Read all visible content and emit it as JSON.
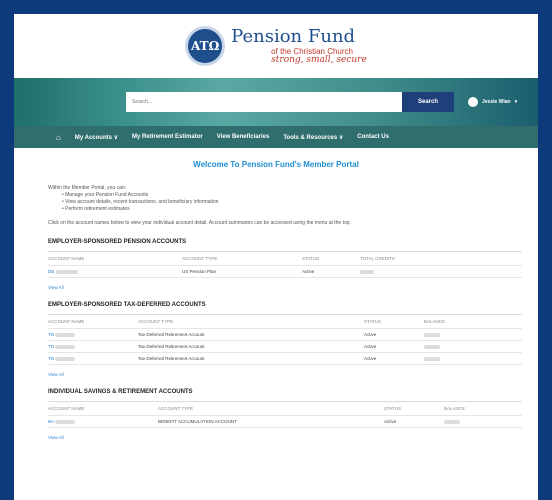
{
  "logo": {
    "title": "Pension Fund",
    "subtitle": "of the Christian Church",
    "tagline": "strong, small, secure",
    "mark": "ATΩ"
  },
  "search": {
    "placeholder": "Search...",
    "button": "Search"
  },
  "user": {
    "name": "Jessie Wian"
  },
  "nav": [
    "My Accounts ∨",
    "My Retirement Estimator",
    "View Beneficiaries",
    "Tools & Resources ∨",
    "Contact Us"
  ],
  "welcome": "Welcome To Pension Fund's Member Portal",
  "intro": {
    "lead": "Within the Member Portal, you can:",
    "bullets": [
      "Manage your Pension Fund Accounts",
      "View account details, recent transactions, and beneficiary information",
      "Perform retirement estimates"
    ],
    "note": "Click on the account names below to view your individual account detail. Account summaries can be accessed using the menu at the top."
  },
  "sections": [
    {
      "title": "EMPLOYER-SPONSORED PENSION ACCOUNTS",
      "headers": [
        "ACCOUNT NAME",
        "ACCOUNT TYPE",
        "STATUS",
        "TOTAL CREDITS"
      ],
      "rows": [
        {
          "name": "DB",
          "type": "US Pension Plan",
          "status": "Active"
        }
      ],
      "view_all": "View All"
    },
    {
      "title": "EMPLOYER-SPONSORED TAX-DEFERRED ACCOUNTS",
      "headers": [
        "ACCOUNT NAME",
        "ACCOUNT TYPE",
        "STATUS",
        "BALANCE"
      ],
      "rows": [
        {
          "name": "TD",
          "type": "Tax-Deferred Retirement Account",
          "status": "Active"
        },
        {
          "name": "TD",
          "type": "Tax-Deferred Retirement Account",
          "status": "Active"
        },
        {
          "name": "TD",
          "type": "Tax-Deferred Retirement Account",
          "status": "Active"
        }
      ],
      "view_all": "View All"
    },
    {
      "title": "INDIVIDUAL SAVINGS & RETIREMENT ACCOUNTS",
      "headers": [
        "ACCOUNT NAME",
        "ACCOUNT TYPE",
        "STATUS",
        "BALANCE"
      ],
      "rows": [
        {
          "name": "BA",
          "type": "BENEFIT ACCUMULATION ACCOUNT",
          "status": "Active"
        }
      ],
      "view_all": "View All"
    }
  ]
}
